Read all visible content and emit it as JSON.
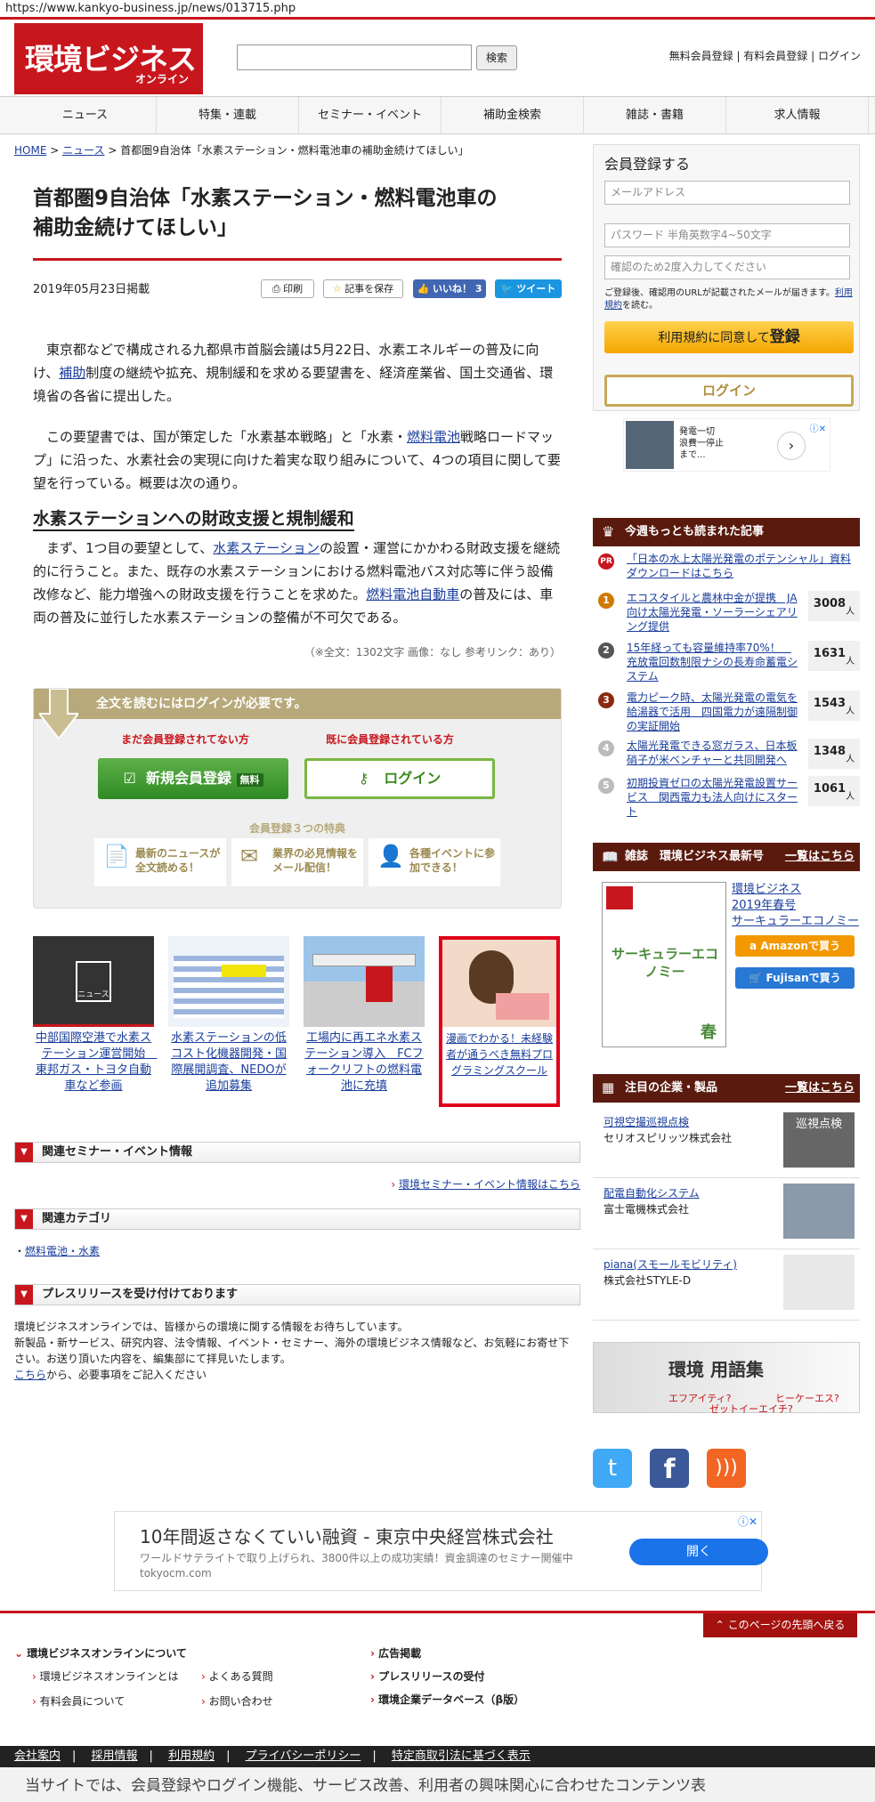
{
  "url": "https://www.kankyo-business.jp/news/013715.php",
  "logo": {
    "main": "環境ビジネス",
    "sub": "オンライン"
  },
  "search": {
    "button": "検索"
  },
  "toplinks": [
    "無料会員登録",
    "有料会員登録",
    "ログイン"
  ],
  "nav": [
    "ニュース",
    "特集・連載",
    "セミナー・イベント",
    "補助金検索",
    "雑誌・書籍",
    "求人情報"
  ],
  "breadcrumb": {
    "home": "HOME",
    "news": "ニュース",
    "current": "首都圏9自治体「水素ステーション・燃料電池車の補助金続けてほしい」"
  },
  "article": {
    "title_l1": "首都圏9自治体「水素ステーション・燃料電池車の",
    "title_l2": "補助金続けてほしい」",
    "date": "2019年05月23日掲載",
    "print": "印刷",
    "save": "記事を保存",
    "like": "いいね！ 3",
    "tweet": "ツイート",
    "p1a": "　東京都などで構成される九都県市首脳会議は5月22日、水素エネルギーの普及に向け、",
    "p1link": "補助",
    "p1b": "制度の継続や拡充、規制緩和を求める要望書を、経済産業省、国土交通省、環境省の各省に提出した。",
    "p2a": "　この要望書では、国が策定した「水素基本戦略」と「水素・",
    "p2link": "燃料電池",
    "p2b": "戦略ロードマップ」に沿った、水素社会の実現に向けた着実な取り組みについて、4つの項目に関して要望を行っている。概要は次の通り。",
    "h2": "水素ステーションへの財政支援と規制緩和",
    "p3a": "　まず、1つ目の要望として、",
    "p3link1": "水素ステーション",
    "p3b": "の設置・運営にかかわる財政支援を継続的に行うこと。また、既存の水素ステーションにおける燃料電池バス対応等に伴う設備改修など、能力増強への財政支援を行うことを求めた。",
    "p3link2": "燃料電池自動車",
    "p3c": "の普及には、車両の普及に並行した水素ステーションの整備が不可欠である。",
    "meta": "（※全文：1302文字 画像：なし 参考リンク：あり）"
  },
  "gate": {
    "bar": "全文を読むにはログインが必要です。",
    "left_label": "まだ会員登録されてない方",
    "right_label": "既に会員登録されている方",
    "reg_btn": "新規会員登録",
    "free": "無料",
    "login_btn": "ログイン",
    "perks_title": "会員登録３つの特典",
    "perks": [
      "最新のニュースが全文読める！",
      "業界の必見情報をメール配信！",
      "各種イベントに参加できる！"
    ]
  },
  "thumbs": [
    {
      "cap": "中部国際空港で水素ステーション運営開始　東邦ガス・トヨタ自動車など参画",
      "tag": "ニュース"
    },
    {
      "cap": "水素ステーションの低コスト化機器開発・国際展開調査、NEDOが追加募集"
    },
    {
      "cap": "工場内に再エネ水素ステーション導入　FCフォークリフトの燃料電池に充填"
    },
    {
      "cap": "漫画でわかる！未経験者が通うべき無料プログラミングスクール"
    }
  ],
  "sections": {
    "seminar": {
      "title": "関連セミナー・イベント情報",
      "link": "環境セミナー・イベント情報はこちら"
    },
    "category": {
      "title": "関連カテゴリ",
      "item": "燃料電池・水素"
    },
    "press": {
      "title": "プレスリリースを受け付けております",
      "l1": "環境ビジネスオンラインでは、皆様からの環境に関する情報をお待ちしています。",
      "l2": "新製品・新サービス、研究内容、法令情報、イベント・セミナー、海外の環境ビジネス情報など、お気軽にお寄せ下さい。お送り頂いた内容を、編集部にて拝見いたします。",
      "link": "こちら",
      "l3": "から、必要事項をご記入ください"
    }
  },
  "side": {
    "reg_title": "会員登録する",
    "email_ph": "メールアドレス",
    "pw_ph": "パスワード 半角英数字4~50文字",
    "pw2_ph": "確認のため2度入力してください",
    "note1": "ご登録後、確認用のURLが記載されたメールが届きます。",
    "note_link": "利用規約",
    "note2": "を読む。",
    "agree_btn": "利用規約に同意して",
    "agree_strong": "登録",
    "login_btn": "ログイン",
    "ad_text": "発電一切\n浪費一停止\nまで...",
    "rank_title": "今週もっとも読まれた記事",
    "pr": "PR",
    "pr_text": "「日本の水上太陽光発電のポテンシャル」資料ダウンロードはこちら",
    "ranks": [
      {
        "n": "1",
        "t": "エコスタイルと農林中金が提携　JA向け太陽光発電・ソーラーシェアリング提供",
        "c": "3008"
      },
      {
        "n": "2",
        "t": "15年経っても容量維持率70%！　充放電回数制限ナシの長寿命蓄電システム",
        "c": "1631"
      },
      {
        "n": "3",
        "t": "電力ピーク時、太陽光発電の電気を給湯器で活用　四国電力が遠隔制御の実証開始",
        "c": "1543"
      },
      {
        "n": "4",
        "t": "太陽光発電できる窓ガラス、日本板硝子が米ベンチャーと共同開発へ",
        "c": "1348"
      },
      {
        "n": "5",
        "t": "初期投資ゼロの太陽光発電設置サービス　関西電力も法人向けにスタート",
        "c": "1061"
      }
    ],
    "person": "人",
    "mag_title": "雑誌　環境ビジネス最新号",
    "mag_more": "一覧はこちら",
    "mag_link1": "環境ビジネス",
    "mag_link2": "2019年春号",
    "mag_link3": "サーキュラーエコノミー",
    "mag_cover": "サーキュラーエコノミー",
    "mag_season": "春",
    "amazon": "Amazonで買う",
    "fujisan": "Fujisanで買う",
    "comp_title": "注目の企業・製品",
    "comp_more": "一覧はこちら",
    "companies": [
      {
        "link": "可視空撮巡視点検",
        "name": "セリオスピリッツ株式会社",
        "img": "巡視点検"
      },
      {
        "link": "配電自動化システム",
        "name": "富士電機株式会社"
      },
      {
        "link": "piana(スモールモビリティ)",
        "name": "株式会社STYLE-D"
      }
    ],
    "glossary": "環境 用語集",
    "gloss_sub1": "エフアイティ?",
    "gloss_sub2": "ヒーケーエス?",
    "gloss_sub3": "ゼットイーエイチ?"
  },
  "ad_bottom": {
    "title": "10年間返さなくていい融資 - 東京中央経営株式会社",
    "desc": "ワールドサテライトで取り上げられ、3800件以上の成功実績！資金調達のセミナー開催中 tokyocm.com",
    "btn": "開く"
  },
  "footer": {
    "pagetop": "このページの先頭へ戻る",
    "about": "環境ビジネスオンラインについて",
    "l1": "環境ビジネスオンラインとは",
    "l2": "有料会員について",
    "l3": "よくある質問",
    "l4": "お問い合わせ",
    "r1": "広告掲載",
    "r2": "プレスリリースの受付",
    "r3": "環境企業データベース（β版）"
  },
  "bottombar": [
    "会社案内",
    "採用情報",
    "利用規約",
    "プライバシーポリシー",
    "特定商取引法に基づく表示"
  ],
  "cookie": "当サイトでは、会員登録やログイン機能、サービス改善、利用者の興味関心に合わせたコンテンツ表"
}
